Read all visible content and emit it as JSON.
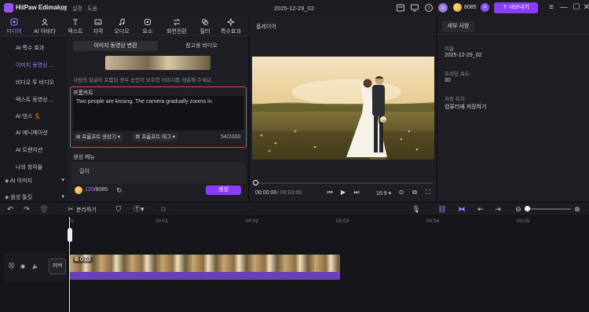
{
  "app": {
    "name": "HitPaw Edimakor",
    "menu": [
      "파일",
      "설정",
      "도움"
    ],
    "document_title": "2025-12-29_02"
  },
  "titlebar": {
    "credits": "8085",
    "export_label": "내보내기"
  },
  "top_tabs": [
    {
      "label": "미디어",
      "icon": "media-icon",
      "active": true
    },
    {
      "label": "AI 아바타",
      "icon": "avatar-icon"
    },
    {
      "label": "텍스트",
      "icon": "text-icon"
    },
    {
      "label": "자막",
      "icon": "subtitle-icon"
    },
    {
      "label": "오디오",
      "icon": "audio-icon"
    },
    {
      "label": "요소",
      "icon": "sticker-icon"
    },
    {
      "label": "화면전환",
      "icon": "transition-icon"
    },
    {
      "label": "필터",
      "icon": "filter-icon"
    },
    {
      "label": "특수효과",
      "icon": "effect-icon"
    }
  ],
  "sidebar": {
    "items": [
      {
        "label": "AI 특수 효과"
      },
      {
        "label": "이미지 동영상 ...",
        "active": true
      },
      {
        "label": "비디오 투 비디오"
      },
      {
        "label": "텍스트 동영상 ..."
      },
      {
        "label": "AI 댄스 💃"
      },
      {
        "label": "AI 애니메이션"
      },
      {
        "label": "AI 트랜지션"
      },
      {
        "label": "나의 창작물"
      }
    ],
    "dropdowns": [
      {
        "label": "AI 이미지"
      },
      {
        "label": "음성 툴킷"
      }
    ]
  },
  "main": {
    "mode_buttons": [
      "이미지 동영상 변환",
      "참고용 비디오"
    ],
    "description": "사람의 얼굴이 포함된 경우 승인이 모호한 이미지를 제출해 주세요.",
    "prompt_label": "프롬프트",
    "prompt_text": "Two people are kissing. The camera gradually zooms in.",
    "prompt_tools": [
      "프롬프트 생성기",
      "프롬프트 태그"
    ],
    "char_count": "54/2000",
    "settings_label": "생성 메뉴",
    "settings_item": "길이",
    "credit_used": "120",
    "credit_total": "/8085",
    "generate_label": "생성"
  },
  "player": {
    "title": "플레이어",
    "time_current": "00:00:00",
    "time_total": "/ 00:03:00",
    "ratio": "16:9"
  },
  "right_panel": {
    "tab": "세부 사항",
    "fields": [
      {
        "label": "이름:",
        "value": "2025-12-29_02"
      },
      {
        "label": "프레임 속도:",
        "value": "30"
      },
      {
        "label": "저장 위치:",
        "value": "컴퓨터에 저장하기"
      }
    ]
  },
  "toolbar": {
    "split_label": "분리하기"
  },
  "timeline": {
    "ruler": [
      "0",
      "00:01",
      "00:02",
      "00:03",
      "00:04",
      "00:05"
    ],
    "clip_duration": "0:03",
    "cover_label": "커버"
  },
  "colors": {
    "accent": "#8b3dff",
    "highlight_border": "#e0473f",
    "audio_track": "#6a3fb8"
  }
}
